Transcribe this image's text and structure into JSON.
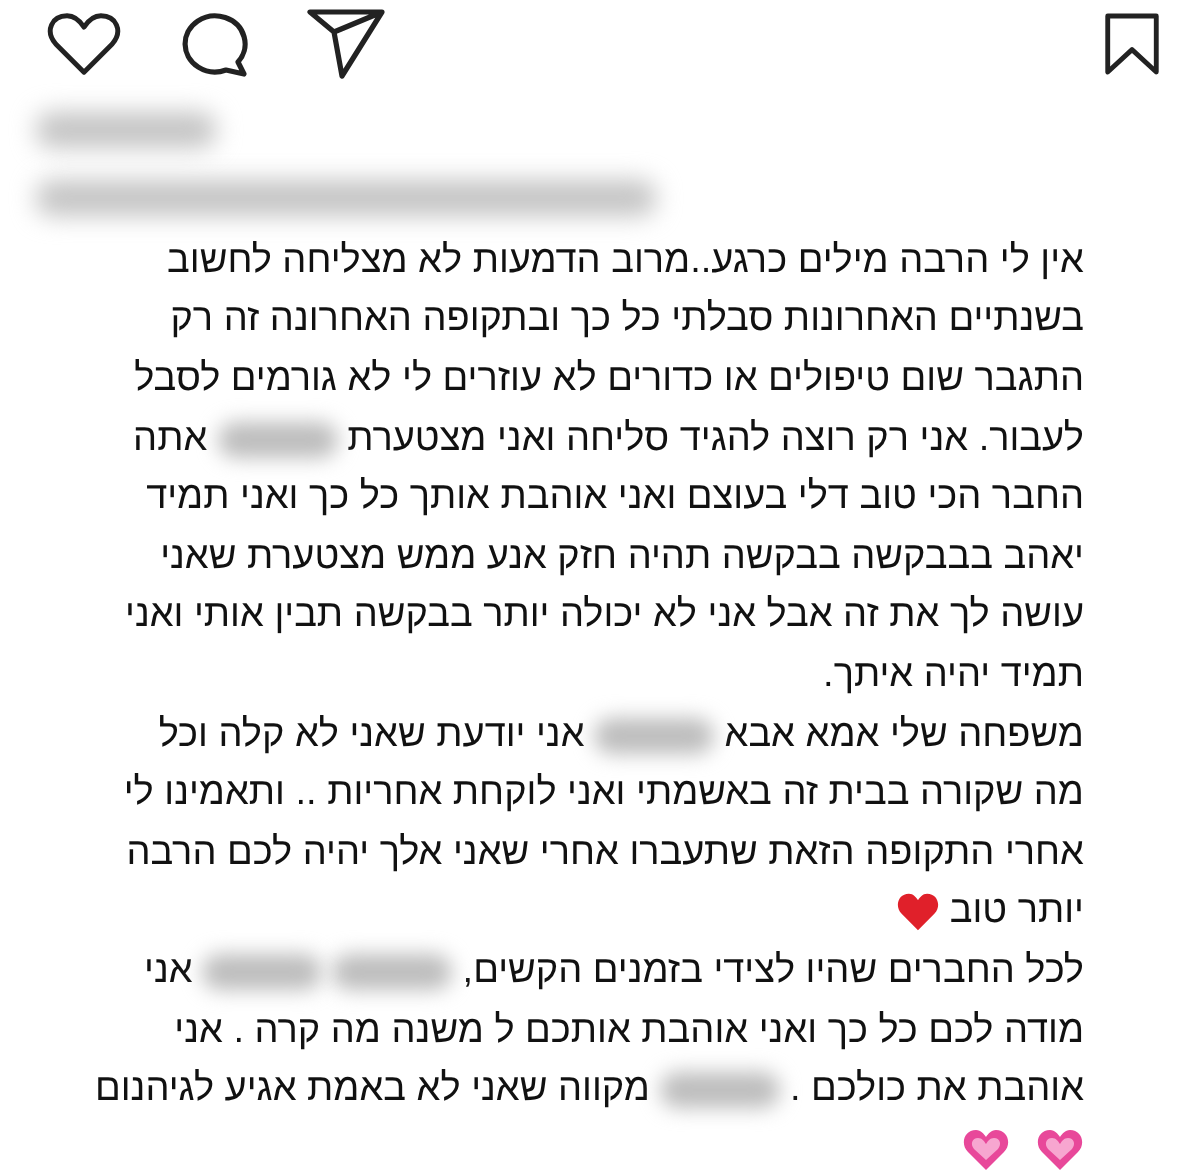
{
  "actions": [
    {
      "kind": "like"
    },
    {
      "kind": "comment"
    },
    {
      "kind": "share"
    },
    {
      "kind": "save"
    }
  ],
  "header": [
    {
      "kind": "blur"
    },
    {
      "kind": "blur"
    }
  ],
  "caption": [
    [
      {
        "kind": "text",
        "text": "אין לי הרבה מילים כרגע..מרוב הדמעות לא מצליחה לחשוב"
      }
    ],
    [
      {
        "kind": "text",
        "text": "בשנתיים האחרונות סבלתי כל כך ובתקופה האחרונה זה רק"
      }
    ],
    [
      {
        "kind": "text",
        "text": "התגבר שום טיפולים או כדורים לא עוזרים לי לא גורמים לסבל"
      }
    ],
    [
      {
        "kind": "text",
        "text": "לעבור. אני רק רוצה להגיד סליחה ואני מצטערת"
      },
      {
        "kind": "blur"
      },
      {
        "kind": "text",
        "text": "אתה"
      }
    ],
    [
      {
        "kind": "text",
        "text": "החבר הכי טוב דלי בעוצם ואני אוהבת אותך כל כך ואני תמיד"
      }
    ],
    [
      {
        "kind": "text",
        "text": "יאהב בבבקשה בבקשה תהיה חזק אנע ממש מצטערת שאני"
      }
    ],
    [
      {
        "kind": "text",
        "text": "עושה לך את זה אבל אני לא יכולה יותר בבקשה תבין אותי ואני"
      }
    ],
    [
      {
        "kind": "text",
        "text": "תמיד יהיה איתך."
      }
    ],
    [
      {
        "kind": "text",
        "text": "משפחה שלי אמא אבא"
      },
      {
        "kind": "blur"
      },
      {
        "kind": "text",
        "text": "אני יודעת שאני לא קלה וכל"
      }
    ],
    [
      {
        "kind": "text",
        "text": "מה שקורה בבית זה באשמתי ואני לוקחת אחריות .. ותאמינו לי"
      }
    ],
    [
      {
        "kind": "text",
        "text": "אחרי התקופה הזאת שתעברו אחרי שאני אלך יהיה לכם הרבה"
      }
    ],
    [
      {
        "kind": "text",
        "text": "יותר טוב"
      },
      {
        "kind": "heart"
      }
    ],
    [
      {
        "kind": "text",
        "text": "לכל החברים שהיו לצידי בזמנים הקשים,"
      },
      {
        "kind": "blur"
      },
      {
        "kind": "blur"
      },
      {
        "kind": "text",
        "text": "אני"
      }
    ],
    [
      {
        "kind": "text",
        "text": "מודה לכם כל כך ואני אוהבת אותכם ל משנה מה קרה . אני"
      }
    ],
    [
      {
        "kind": "text",
        "text": "אוהבת את כולכם ."
      },
      {
        "kind": "blur"
      },
      {
        "kind": "text",
        "text": "מקווה שאני לא באמת אגיע לגיהנום"
      }
    ],
    [
      {
        "kind": "pink-heart"
      },
      {
        "kind": "pink-heart"
      }
    ]
  ]
}
